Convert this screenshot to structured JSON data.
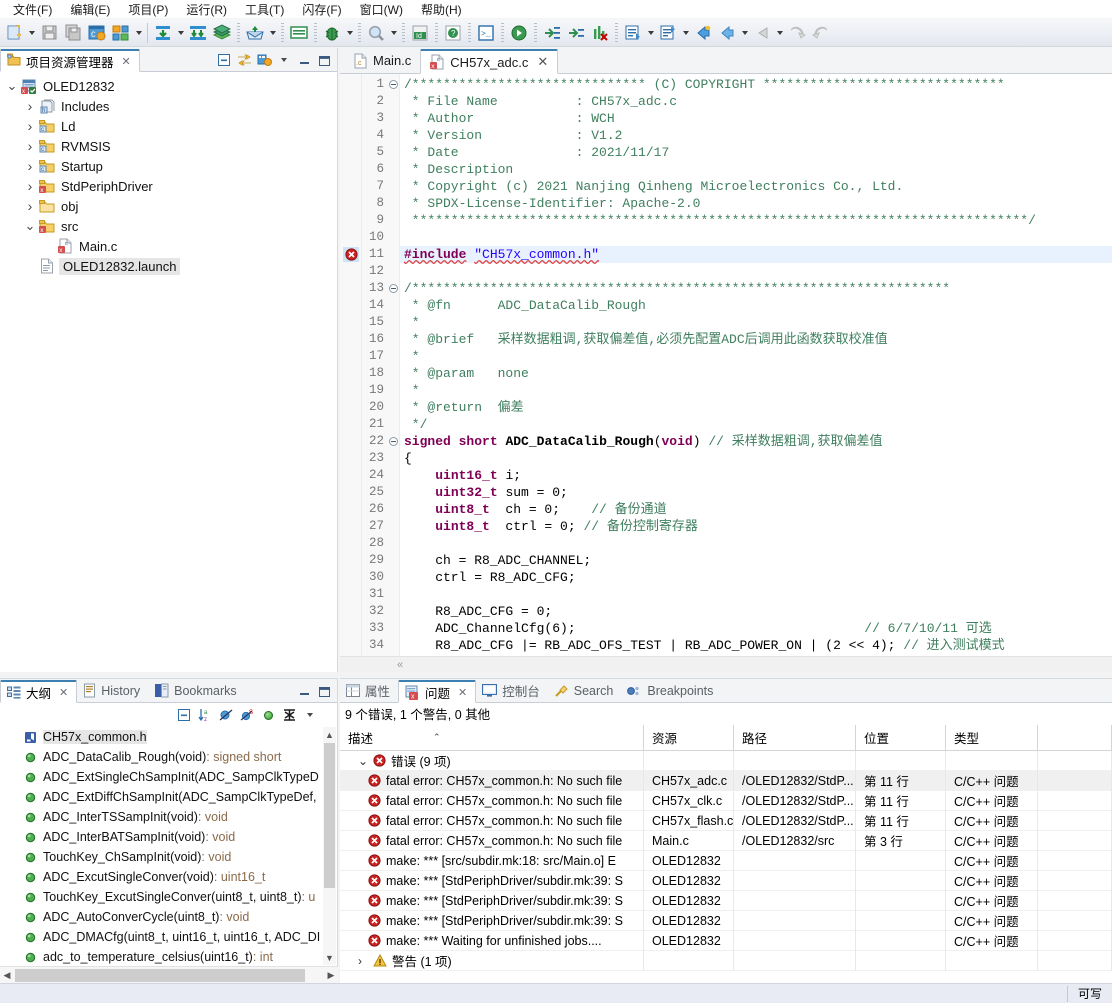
{
  "menu": {
    "items": [
      "文件(F)",
      "编辑(E)",
      "项目(P)",
      "运行(R)",
      "工具(T)",
      "闪存(F)",
      "窗口(W)",
      "帮助(H)"
    ]
  },
  "toolbar": {
    "icons": [
      "new-file-icon",
      "save-icon",
      "save-all-icon",
      "build-config-icon",
      "build-all-icon",
      "import-icon",
      "import-all-icon",
      "library-icon",
      "export-icon",
      "console-icon",
      "debug-bug-icon",
      "search-icon",
      "id-icon",
      "help-icon",
      "terminal-icon",
      "run-icon",
      "step-into-icon",
      "step-over-icon",
      "chart-error-icon",
      "next-annotation-icon",
      "prev-annotation-icon",
      "back-icon",
      "forward-icon",
      "undo-nav-icon",
      "redo-nav-icon"
    ]
  },
  "project_explorer": {
    "tab_label": "项目资源管理器",
    "tab_icon": "project-explorer-icon",
    "actions": [
      "collapse-all-icon",
      "link-with-editor-icon",
      "view-menu-icon",
      "minimize-icon",
      "maximize-icon"
    ],
    "tree": [
      {
        "label": "OLED12832",
        "icon": "project-icon",
        "twisty": "v",
        "indent": 0,
        "selected": false
      },
      {
        "label": "Includes",
        "icon": "includes-icon",
        "twisty": ">",
        "indent": 1,
        "selected": false
      },
      {
        "label": "Ld",
        "icon": "folder-src-icon",
        "twisty": ">",
        "indent": 1,
        "selected": false
      },
      {
        "label": "RVMSIS",
        "icon": "folder-src-icon",
        "twisty": ">",
        "indent": 1,
        "selected": false
      },
      {
        "label": "Startup",
        "icon": "folder-src-icon",
        "twisty": ">",
        "indent": 1,
        "selected": false
      },
      {
        "label": "StdPeriphDriver",
        "icon": "folder-src-error-icon",
        "twisty": ">",
        "indent": 1,
        "selected": false
      },
      {
        "label": "obj",
        "icon": "folder-plain-icon",
        "twisty": ">",
        "indent": 1,
        "selected": false
      },
      {
        "label": "src",
        "icon": "folder-src-error-icon",
        "twisty": "v",
        "indent": 1,
        "selected": false
      },
      {
        "label": "Main.c",
        "icon": "c-file-error-icon",
        "twisty": "",
        "indent": 2,
        "selected": false
      },
      {
        "label": "OLED12832.launch",
        "icon": "launch-file-icon",
        "twisty": "",
        "indent": 1,
        "selected": true
      }
    ]
  },
  "outline": {
    "tabs": [
      {
        "label": "大纲",
        "icon": "outline-icon",
        "active": true,
        "closable": true
      },
      {
        "label": "History",
        "icon": "history-icon",
        "active": false,
        "closable": false
      },
      {
        "label": "Bookmarks",
        "icon": "bookmarks-icon",
        "active": false,
        "closable": false
      }
    ],
    "panel_actions": [
      "minimize-icon",
      "maximize-icon"
    ],
    "toolbar_icons": [
      "collapse-all-icon",
      "sort-az-icon",
      "hide-fields-icon",
      "hide-static-icon",
      "hide-nonpublic-icon",
      "filter-icon",
      "view-menu-icon"
    ],
    "items": [
      {
        "name": "CH57x_common.h",
        "type": "",
        "icon": "include-icon",
        "selected": true
      },
      {
        "name": "ADC_DataCalib_Rough(void)",
        "type": " : signed short",
        "icon": "method-icon",
        "selected": false
      },
      {
        "name": "ADC_ExtSingleChSampInit(ADC_SampClkTypeD",
        "type": "",
        "icon": "method-icon",
        "selected": false
      },
      {
        "name": "ADC_ExtDiffChSampInit(ADC_SampClkTypeDef,",
        "type": "",
        "icon": "method-icon",
        "selected": false
      },
      {
        "name": "ADC_InterTSSampInit(void)",
        "type": " : void",
        "icon": "method-icon",
        "selected": false
      },
      {
        "name": "ADC_InterBATSampInit(void)",
        "type": " : void",
        "icon": "method-icon",
        "selected": false
      },
      {
        "name": "TouchKey_ChSampInit(void)",
        "type": " : void",
        "icon": "method-icon",
        "selected": false
      },
      {
        "name": "ADC_ExcutSingleConver(void)",
        "type": " : uint16_t",
        "icon": "method-icon",
        "selected": false
      },
      {
        "name": "TouchKey_ExcutSingleConver(uint8_t, uint8_t)",
        "type": " : u",
        "icon": "method-icon",
        "selected": false
      },
      {
        "name": "ADC_AutoConverCycle(uint8_t)",
        "type": " : void",
        "icon": "method-icon",
        "selected": false
      },
      {
        "name": "ADC_DMACfg(uint8_t, uint16_t, uint16_t, ADC_DI",
        "type": "",
        "icon": "method-icon",
        "selected": false
      },
      {
        "name": "adc_to_temperature_celsius(uint16_t)",
        "type": " : int",
        "icon": "method-icon",
        "selected": false
      }
    ]
  },
  "editor": {
    "tabs": [
      {
        "label": "Main.c",
        "icon": "c-file-icon",
        "active": false,
        "closable": false
      },
      {
        "label": "CH57x_adc.c",
        "icon": "c-file-error-icon",
        "active": true,
        "closable": true
      }
    ],
    "error_marker_line": 11,
    "highlighted_line": 11,
    "lines": [
      {
        "n": 1,
        "fold": "minus",
        "text": "/****************************** (C) COPYRIGHT *******************************",
        "cls": "c-comment"
      },
      {
        "n": 2,
        "fold": "",
        "text": " * File Name          : CH57x_adc.c",
        "cls": "c-comment"
      },
      {
        "n": 3,
        "fold": "",
        "text": " * Author             : WCH",
        "cls": "c-comment"
      },
      {
        "n": 4,
        "fold": "",
        "text": " * Version            : V1.2",
        "cls": "c-comment"
      },
      {
        "n": 5,
        "fold": "",
        "text": " * Date               : 2021/11/17",
        "cls": "c-comment"
      },
      {
        "n": 6,
        "fold": "",
        "text": " * Description",
        "cls": "c-comment"
      },
      {
        "n": 7,
        "fold": "",
        "text": " * Copyright (c) 2021 Nanjing Qinheng Microelectronics Co., Ltd.",
        "cls": "c-comment"
      },
      {
        "n": 8,
        "fold": "",
        "text": " * SPDX-License-Identifier: Apache-2.0",
        "cls": "c-comment"
      },
      {
        "n": 9,
        "fold": "",
        "text": " *******************************************************************************/",
        "cls": "c-comment"
      },
      {
        "n": 10,
        "fold": "",
        "text": "",
        "cls": ""
      },
      {
        "n": 11,
        "fold": "",
        "text": "#include \"CH57x_common.h\"",
        "cls": "c-pp"
      },
      {
        "n": 12,
        "fold": "",
        "text": "",
        "cls": ""
      },
      {
        "n": 13,
        "fold": "minus",
        "text": "/*********************************************************************",
        "cls": "c-comment"
      },
      {
        "n": 14,
        "fold": "",
        "text": " * @fn      ADC_DataCalib_Rough",
        "cls": "c-comment"
      },
      {
        "n": 15,
        "fold": "",
        "text": " *",
        "cls": "c-comment"
      },
      {
        "n": 16,
        "fold": "",
        "text": " * @brief   采样数据粗调,获取偏差值,必须先配置ADC后调用此函数获取校准值",
        "cls": "c-comment"
      },
      {
        "n": 17,
        "fold": "",
        "text": " *",
        "cls": "c-comment"
      },
      {
        "n": 18,
        "fold": "",
        "text": " * @param   none",
        "cls": "c-comment"
      },
      {
        "n": 19,
        "fold": "",
        "text": " *",
        "cls": "c-comment"
      },
      {
        "n": 20,
        "fold": "",
        "text": " * @return  偏差",
        "cls": "c-comment"
      },
      {
        "n": 21,
        "fold": "",
        "text": " */",
        "cls": "c-comment"
      },
      {
        "n": 22,
        "fold": "minus",
        "text": "signed short ADC_DataCalib_Rough(void) // 采样数据粗调,获取偏差值",
        "cls": "code"
      },
      {
        "n": 23,
        "fold": "",
        "text": "{",
        "cls": "code"
      },
      {
        "n": 24,
        "fold": "",
        "text": "    uint16_t i;",
        "cls": "code"
      },
      {
        "n": 25,
        "fold": "",
        "text": "    uint32_t sum = 0;",
        "cls": "code"
      },
      {
        "n": 26,
        "fold": "",
        "text": "    uint8_t  ch = 0;    // 备份通道",
        "cls": "code"
      },
      {
        "n": 27,
        "fold": "",
        "text": "    uint8_t  ctrl = 0; // 备份控制寄存器",
        "cls": "code"
      },
      {
        "n": 28,
        "fold": "",
        "text": "",
        "cls": ""
      },
      {
        "n": 29,
        "fold": "",
        "text": "    ch = R8_ADC_CHANNEL;",
        "cls": "code"
      },
      {
        "n": 30,
        "fold": "",
        "text": "    ctrl = R8_ADC_CFG;",
        "cls": "code"
      },
      {
        "n": 31,
        "fold": "",
        "text": "",
        "cls": ""
      },
      {
        "n": 32,
        "fold": "",
        "text": "    R8_ADC_CFG = 0;",
        "cls": "code"
      },
      {
        "n": 33,
        "fold": "",
        "text": "    ADC_ChannelCfg(6);                                     // 6/7/10/11 可选",
        "cls": "code"
      },
      {
        "n": 34,
        "fold": "",
        "text": "    R8_ADC_CFG |= RB_ADC_OFS_TEST | RB_ADC_POWER_ON | (2 << 4); // 进入测试模式",
        "cls": "code"
      }
    ]
  },
  "problems": {
    "tabs": [
      {
        "label": "属性",
        "icon": "properties-icon",
        "active": false,
        "closable": false
      },
      {
        "label": "问题",
        "icon": "problems-icon",
        "active": true,
        "closable": true
      },
      {
        "label": "控制台",
        "icon": "console-icon",
        "active": false,
        "closable": false
      },
      {
        "label": "Search",
        "icon": "search-icon",
        "active": false,
        "closable": false
      },
      {
        "label": "Breakpoints",
        "icon": "breakpoints-icon",
        "active": false,
        "closable": false
      }
    ],
    "summary": "9 个错误, 1 个警告, 0 其他",
    "columns": [
      "描述",
      "资源",
      "路径",
      "位置",
      "类型"
    ],
    "sort_column": 0,
    "groups": [
      {
        "label": "错误 (9 项)",
        "icon": "error-icon",
        "expanded": true,
        "rows": [
          {
            "desc": "fatal error: CH57x_common.h: No such file",
            "resource": "CH57x_adc.c",
            "path": "/OLED12832/StdP...",
            "location": "第 11 行",
            "type": "C/C++ 问题",
            "icon": "error-icon",
            "selected": true
          },
          {
            "desc": "fatal error: CH57x_common.h: No such file",
            "resource": "CH57x_clk.c",
            "path": "/OLED12832/StdP...",
            "location": "第 11 行",
            "type": "C/C++ 问题",
            "icon": "error-icon",
            "selected": false
          },
          {
            "desc": "fatal error: CH57x_common.h: No such file",
            "resource": "CH57x_flash.c",
            "path": "/OLED12832/StdP...",
            "location": "第 11 行",
            "type": "C/C++ 问题",
            "icon": "error-icon",
            "selected": false
          },
          {
            "desc": "fatal error: CH57x_common.h: No such file",
            "resource": "Main.c",
            "path": "/OLED12832/src",
            "location": "第 3 行",
            "type": "C/C++ 问题",
            "icon": "error-icon",
            "selected": false
          },
          {
            "desc": "make: *** [src/subdir.mk:18: src/Main.o] E",
            "resource": "OLED12832",
            "path": "",
            "location": "",
            "type": "C/C++ 问题",
            "icon": "error-icon",
            "selected": false
          },
          {
            "desc": "make: *** [StdPeriphDriver/subdir.mk:39: S",
            "resource": "OLED12832",
            "path": "",
            "location": "",
            "type": "C/C++ 问题",
            "icon": "error-icon",
            "selected": false
          },
          {
            "desc": "make: *** [StdPeriphDriver/subdir.mk:39: S",
            "resource": "OLED12832",
            "path": "",
            "location": "",
            "type": "C/C++ 问题",
            "icon": "error-icon",
            "selected": false
          },
          {
            "desc": "make: *** [StdPeriphDriver/subdir.mk:39: S",
            "resource": "OLED12832",
            "path": "",
            "location": "",
            "type": "C/C++ 问题",
            "icon": "error-icon",
            "selected": false
          },
          {
            "desc": "make: *** Waiting for unfinished jobs....",
            "resource": "OLED12832",
            "path": "",
            "location": "",
            "type": "C/C++ 问题",
            "icon": "error-icon",
            "selected": false
          }
        ]
      },
      {
        "label": "警告 (1 项)",
        "icon": "warning-icon",
        "expanded": false,
        "rows": []
      }
    ]
  },
  "statusbar": {
    "writable_label": "可写"
  },
  "colors": {
    "accent": "#3c7fb1",
    "error": "#cc0000",
    "warning": "#f0c040",
    "comment": "#3f7f5f",
    "keyword": "#7f0055",
    "string": "#2a00ff",
    "selection": "#e8f2fe"
  }
}
